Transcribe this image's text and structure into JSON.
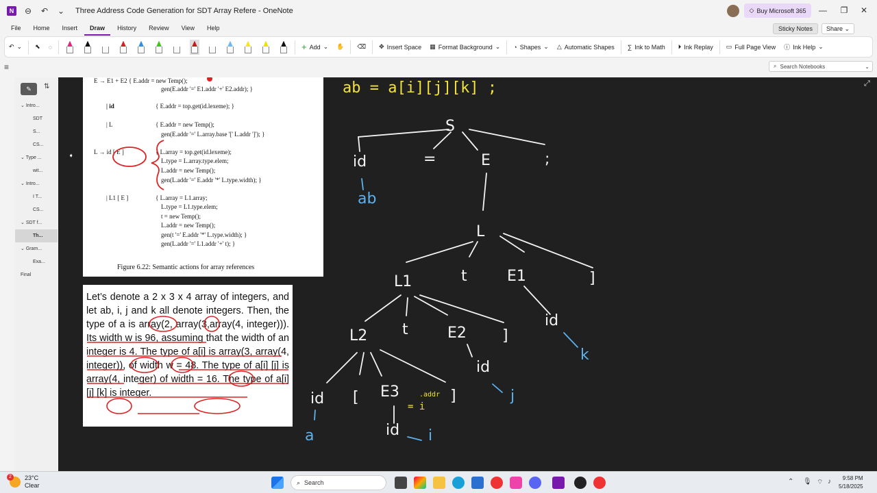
{
  "window": {
    "title": "Three Address Code Generation for SDT Array Refere - OneNote",
    "buy_label": "Buy Microsoft 365"
  },
  "menu": [
    "File",
    "Home",
    "Insert",
    "Draw",
    "History",
    "Review",
    "View",
    "Help"
  ],
  "menu_active": "Draw",
  "sticky_label": "Sticky Notes",
  "share_label": "Share",
  "ribbon": {
    "add": "Add",
    "insert_space": "Insert Space",
    "format_background": "Format Background",
    "shapes": "Shapes",
    "automatic_shapes": "Automatic Shapes",
    "ink_to_math": "Ink to Math",
    "ink_replay": "Ink Replay",
    "full_page_view": "Full Page View",
    "ink_help": "Ink Help",
    "pens": [
      {
        "color": "#e0277a",
        "icon": "highlighter-icon"
      },
      {
        "color": "#111111",
        "icon": "pen-icon"
      },
      {
        "color": "#ffffff",
        "icon": "pen-icon"
      },
      {
        "color": "#d62020",
        "icon": "pen-icon"
      },
      {
        "color": "#2f8fe0",
        "icon": "pen-icon"
      },
      {
        "color": "#46c21e",
        "icon": "highlighter-icon"
      },
      {
        "color": "#ffffff",
        "icon": "pen-icon"
      },
      {
        "color": "#c41a1a",
        "icon": "pen-icon"
      },
      {
        "color": "#ffffff",
        "icon": "pen-icon"
      },
      {
        "color": "#6fb8f5",
        "icon": "pen-icon"
      },
      {
        "color": "#f5e623",
        "icon": "highlighter-icon"
      },
      {
        "color": "#f0e000",
        "icon": "pen-icon"
      },
      {
        "color": "#111111",
        "icon": "pen-icon"
      }
    ]
  },
  "search_notebooks": "Search Notebooks",
  "sidebar": {
    "items": [
      {
        "label": "Intro...",
        "caret": "v",
        "indent": 0
      },
      {
        "label": "SDT",
        "indent": 1
      },
      {
        "label": "S...",
        "indent": 1
      },
      {
        "label": "CS...",
        "indent": 1
      },
      {
        "label": "Type ...",
        "caret": "v",
        "indent": 0
      },
      {
        "label": "wit...",
        "indent": 1
      },
      {
        "label": "Intro...",
        "caret": "v",
        "indent": 0
      },
      {
        "label": "I T...",
        "indent": 1
      },
      {
        "label": "CS...",
        "indent": 1
      },
      {
        "label": "SDT f...",
        "caret": "v",
        "indent": 0
      },
      {
        "label": "Th...",
        "indent": 1,
        "selected": true
      },
      {
        "label": "Gram...",
        "caret": "v",
        "indent": 0
      },
      {
        "label": "Exa...",
        "indent": 1
      },
      {
        "label": "Final",
        "indent": 0
      }
    ]
  },
  "figure": {
    "lines": [
      "E → E1 + E2   { E.addr = new Temp();",
      "gen(E.addr '=' E1.addr '+' E2.addr); }",
      "| id",
      "{ E.addr = top.get(id.lexeme); }",
      "| L",
      "{ E.addr = new Temp();",
      "gen(E.addr '=' L.array.base '[' L.addr ']'); }",
      "L → id [ E ]",
      "{ L.array = top.get(id.lexeme);",
      "L.type = L.array.type.elem;",
      "L.addr = new Temp();",
      "gen(L.addr '=' E.addr '*' L.type.width); }",
      "| L1 [ E ]",
      "{ L.array = L1.array;",
      "L.type = L1.type.elem;",
      "t = new Temp();",
      "L.addr = new Temp();",
      "gen(t '=' E.addr '*' L.type.width); }",
      "gen(L.addr '=' L1.addr '+' t); }"
    ],
    "caption": "Figure 6.22: Semantic actions for array references"
  },
  "textbox": "Let’s denote a 2 x 3 x 4 array of integers, and let ab, i, j and k all denote integers. Then, the type of a is array(2, array(3,array(4, integer))). Its width w is 96, assuming that the width of an integer is 4. The type of a[i] is array(3, array(4, integer)), of width w = 48. The type of a[i] [j] is array(4, integer) of width = 16. The type of a[i] [j] [k] is integer.",
  "ink": {
    "statement": "ab = a[i][j][k] ;",
    "nodes": [
      "S",
      "id",
      "=",
      "E",
      ";",
      "ab",
      "L",
      "L1",
      "t",
      "E1",
      "]",
      "L2",
      "t",
      "E2",
      "]",
      "id",
      "k",
      "id",
      "[",
      "E3",
      "]",
      "id",
      "j",
      "a",
      "id",
      "i",
      ".addr",
      "= i"
    ]
  },
  "taskbar": {
    "temp": "23°C",
    "condition": "Clear",
    "badge": "2",
    "search": "Search",
    "time": "9:58 PM",
    "date": "5/18/2025"
  }
}
